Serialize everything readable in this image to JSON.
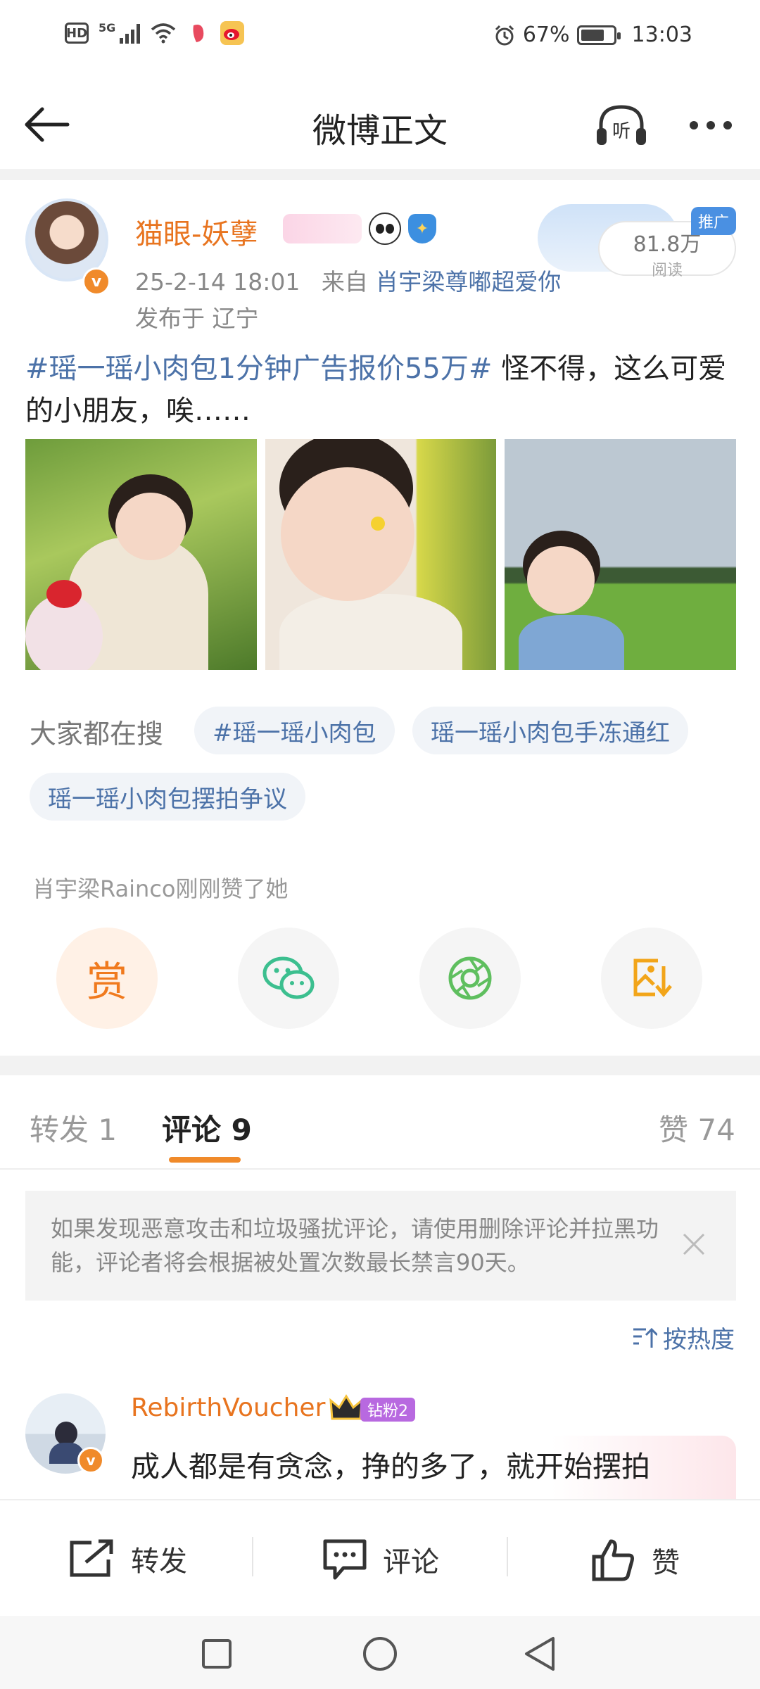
{
  "status_bar": {
    "network": "5G",
    "hd": "HD",
    "battery": "67%",
    "battery_level": 0.67,
    "time": "13:03"
  },
  "header": {
    "title": "微博正文",
    "listen_label": "听"
  },
  "post": {
    "author": "猫眼-妖孽",
    "verified_mark": "v",
    "time": "25-2-14 18:01",
    "from_prefix": "来自",
    "source": "肖宇梁尊嘟超爱你",
    "location": "发布于 辽宁",
    "promo_tag": "推广",
    "read_count": "81.8万",
    "read_label": "阅读",
    "topic": "#瑶一瑶小肉包1分钟广告报价55万#",
    "text": " 怪不得，这么可爱的小朋友，唉……"
  },
  "searching": {
    "label": "大家都在搜",
    "chips": [
      "#瑶一瑶小肉包",
      "瑶一瑶小肉包手冻通红",
      "瑶一瑶小肉包摆拍争议"
    ]
  },
  "liked_notice": "肖宇梁Rainco刚刚赞了她",
  "actions": {
    "reward": "赏"
  },
  "tabs": {
    "repost": "转发 1",
    "comment": "评论 9",
    "like": "赞 74"
  },
  "notice": {
    "text": "如果发现恶意攻击和垃圾骚扰评论，请使用删除评论并拉黑功能，评论者将会根据被处置次数最长禁言90天。"
  },
  "sort_label": "按热度",
  "comment": {
    "user": "RebirthVoucher",
    "fan_badge": "钻粉2",
    "text": "成人都是有贪念，挣的多了，就开始摆拍"
  },
  "bottom_bar": {
    "repost": "转发",
    "comment": "评论",
    "like": "赞"
  },
  "colors": {
    "accent_orange": "#f08a2a",
    "link_blue": "#4c72a8",
    "name_orange": "#e8741f"
  }
}
